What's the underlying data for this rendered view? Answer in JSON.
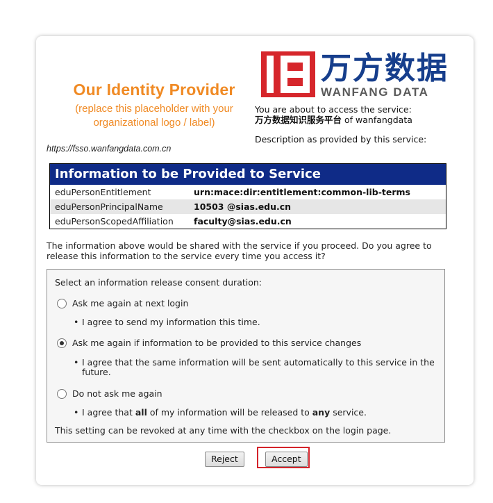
{
  "idp_logo": {
    "title": "Our Identity Provider",
    "subtitle_line1": "(replace this placeholder with your",
    "subtitle_line2": "organizational logo / label)"
  },
  "idp_url": "https://fsso.wanfangdata.com.cn",
  "sp_logo": {
    "cn_text": "万方数据",
    "en_text": "WANFANG DATA",
    "brand_red": "#d6262b",
    "brand_blue": "#163e8c"
  },
  "service": {
    "intro": "You are about to access the service:",
    "name": "万方数据知识服务平台",
    "of_text": " of wanfangdata",
    "description_label": "Description as provided by this service:"
  },
  "info_table": {
    "header": "Information to be Provided to Service",
    "rows": [
      {
        "attribute": "eduPersonEntitlement",
        "value": "urn:mace:dir:entitlement:common-lib-terms"
      },
      {
        "attribute": "eduPersonPrincipalName",
        "value": "10503 @sias.edu.cn"
      },
      {
        "attribute": "eduPersonScopedAffiliation",
        "value": "faculty@sias.edu.cn"
      }
    ]
  },
  "question": "The information above would be shared with the service if you proceed. Do you agree to release this information to the service every time you access it?",
  "consent": {
    "title": "Select an information release consent duration:",
    "options": [
      {
        "label": "Ask me again at next login",
        "checked": false,
        "bullet": "I agree to send my information this time."
      },
      {
        "label": "Ask me again if information to be provided to this service changes",
        "checked": true,
        "bullet": "I agree that the same information will be sent automatically to this service in the future."
      },
      {
        "label": "Do not ask me again",
        "checked": false,
        "bullet_pre": "I agree that ",
        "bullet_all": "all",
        "bullet_mid": " of my information will be released to ",
        "bullet_any": "any",
        "bullet_post": " service."
      }
    ],
    "footer": "This setting can be revoked at any time with the checkbox on the login page."
  },
  "buttons": {
    "reject": "Reject",
    "accept": "Accept"
  }
}
